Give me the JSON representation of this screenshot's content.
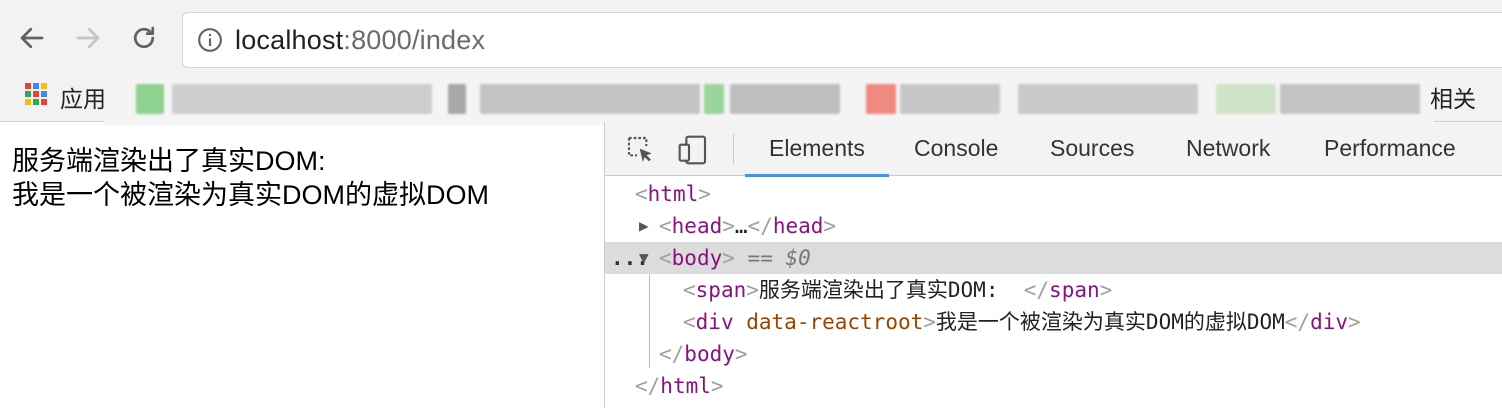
{
  "browser": {
    "url_host": "localhost",
    "url_rest": ":8000/index",
    "bookmarks": {
      "apps_label": "应用",
      "related_label": "相关"
    }
  },
  "page": {
    "lines": [
      "服务端渲染出了真实DOM:",
      "我是一个被渲染为真实DOM的虚拟DOM"
    ]
  },
  "devtools": {
    "tabs": [
      "Elements",
      "Console",
      "Sources",
      "Network",
      "Performance"
    ],
    "active_tab": "Elements",
    "tree": {
      "html_open": "html",
      "head_tag": "head",
      "head_ellipsis": "…",
      "body_tag": "body",
      "body_marker": "== $0",
      "row_dots": "...",
      "span_tag": "span",
      "span_text": "服务端渲染出了真实DOM:  ",
      "div_tag": "div",
      "div_attr": "data-reactroot",
      "div_text": "我是一个被渲染为真实DOM的虚拟DOM"
    }
  },
  "colors": {
    "tag": "#881280",
    "attr": "#994500",
    "active_tab_underline": "#4a90e2",
    "selected_row": "#dcdcdc"
  }
}
